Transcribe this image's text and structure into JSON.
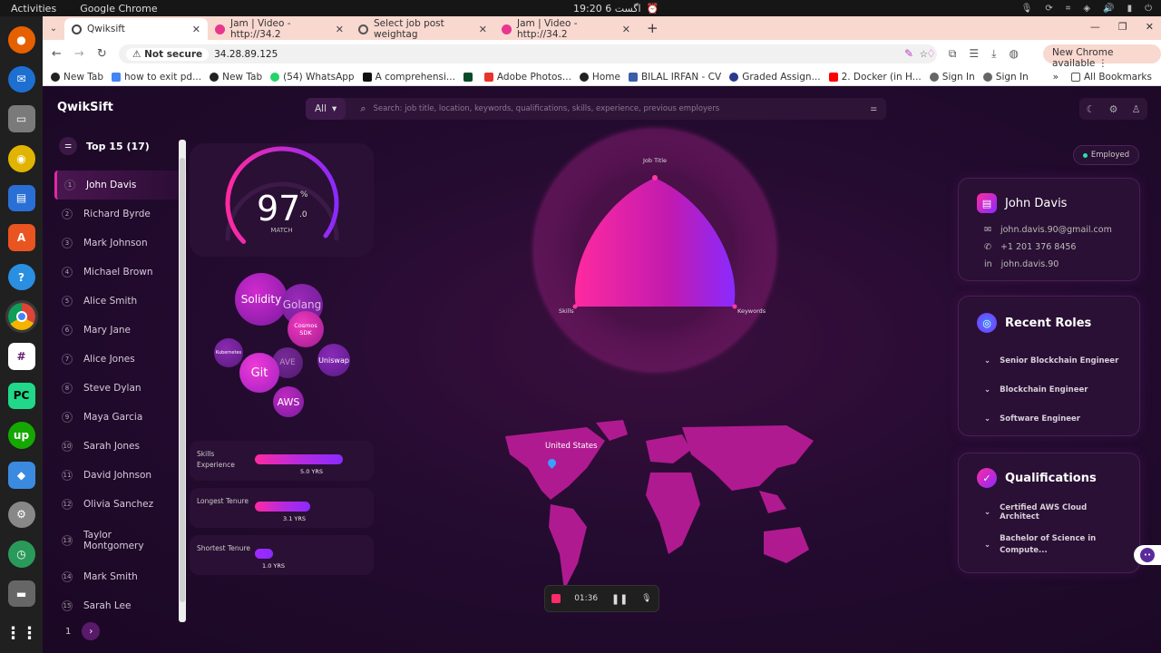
{
  "os": {
    "activities": "Activities",
    "app": "Google Chrome",
    "clock": "19:20  6 اگست"
  },
  "tabs": [
    {
      "title": "Qwiksift",
      "color": "#444"
    },
    {
      "title": "Jam | Video - http://34.2",
      "color": "#e8368f"
    },
    {
      "title": "Select job post weightag",
      "color": "#555"
    },
    {
      "title": "Jam | Video - http://34.2",
      "color": "#e8368f"
    }
  ],
  "address": {
    "security": "Not secure",
    "url": "34.28.89.125",
    "new_chrome": "New Chrome available"
  },
  "bookmarks": [
    "New Tab",
    "how to exit pd...",
    "New Tab",
    "(54) WhatsApp",
    "A comprehensi...",
    "",
    "Adobe Photos...",
    "Home",
    "BILAL IRFAN - CV",
    "Graded Assign...",
    "2. Docker (in H...",
    "Sign In",
    "Sign In"
  ],
  "bookmarks_all": "All Bookmarks",
  "app": {
    "logo": "QwikSift",
    "search_filter": "All",
    "search_placeholder": "Search: job title, location, keywords, qualifications, skills, experience, previous employers"
  },
  "list": {
    "title": "Top 15 (17)",
    "candidates": [
      "John Davis",
      "Richard Byrde",
      "Mark Johnson",
      "Michael Brown",
      "Alice Smith",
      "Mary Jane",
      "Alice Jones",
      "Steve Dylan",
      "Maya Garcia",
      "Sarah Jones",
      "David Johnson",
      "Olivia Sanchez",
      "Taylor Montgomery",
      "Mark Smith",
      "Sarah Lee"
    ],
    "numbers": [
      "1",
      "2",
      "3",
      "4",
      "5",
      "6",
      "7",
      "8",
      "9",
      "10",
      "11",
      "12",
      "13",
      "14",
      "15"
    ],
    "page": "1"
  },
  "score": {
    "value": "97",
    "unit": "%",
    "decimal": ".0",
    "label": "MATCH",
    "fraction": 0.97
  },
  "skills": [
    "Solidity",
    "Golang",
    "Cosmos SDK",
    "Kubernetes",
    "AVE",
    "Uniswap",
    "Git",
    "AWS"
  ],
  "metrics": [
    {
      "label": "Skills Experience",
      "value": "5.0 YRS"
    },
    {
      "label": "Longest Tenure",
      "value": "3.1 YRS"
    },
    {
      "label": "Shortest Tenure",
      "value": "1.0 YRS"
    }
  ],
  "radar": {
    "top": "Job Title",
    "left": "Skills",
    "right": "Keywords"
  },
  "map": {
    "location": "United States"
  },
  "recorder": {
    "time": "01:36"
  },
  "status": "Employed",
  "profile": {
    "name": "John Davis",
    "email": "john.davis.90@gmail.com",
    "phone": "+1 201 376 8456",
    "linkedin": "john.davis.90"
  },
  "roles": {
    "title": "Recent Roles",
    "items": [
      "Senior Blockchain Engineer",
      "Blockchain Engineer",
      "Software Engineer"
    ]
  },
  "qualifications": {
    "title": "Qualifications",
    "items": [
      "Certified AWS Cloud Architect",
      "Bachelor of Science in Compute..."
    ]
  }
}
